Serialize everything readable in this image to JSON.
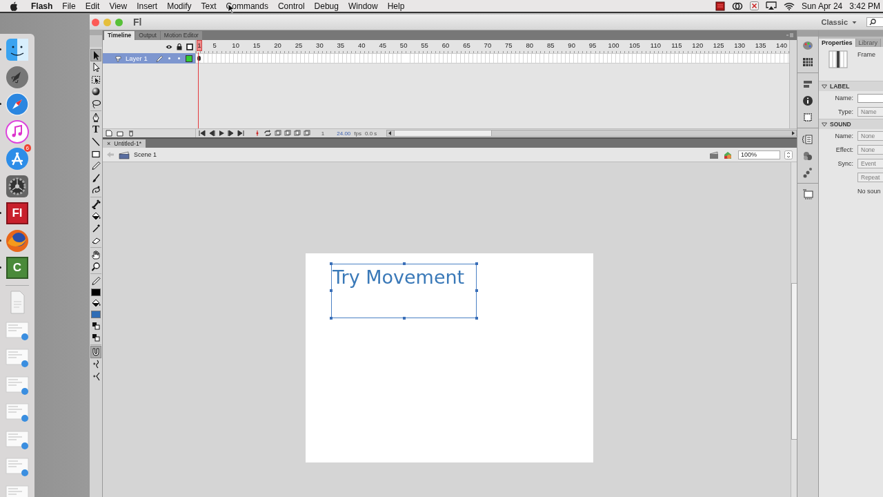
{
  "menubar": {
    "app": "Flash",
    "menus": [
      "File",
      "Edit",
      "View",
      "Insert",
      "Modify",
      "Text",
      "Commands",
      "Control",
      "Debug",
      "Window",
      "Help"
    ],
    "date": "Sun Apr 24",
    "time": "3:42 PM"
  },
  "dock": {
    "items": [
      {
        "kind": "finder",
        "running": true
      },
      {
        "kind": "rocket",
        "running": false
      },
      {
        "kind": "compass",
        "running": true
      },
      {
        "kind": "music",
        "running": false
      },
      {
        "kind": "appstore",
        "running": false,
        "badge": "6"
      },
      {
        "kind": "gear",
        "running": false
      },
      {
        "kind": "tile",
        "label": "Fl",
        "color": "#c8202c",
        "running": true
      },
      {
        "kind": "globe",
        "running": true
      },
      {
        "kind": "tile",
        "label": "C",
        "color": "#4a8a3a",
        "running": true
      },
      {
        "kind": "divider"
      },
      {
        "kind": "document"
      },
      {
        "kind": "thumbnail"
      },
      {
        "kind": "thumbnail"
      },
      {
        "kind": "thumbnail"
      },
      {
        "kind": "thumbnail"
      },
      {
        "kind": "thumbnail"
      },
      {
        "kind": "thumbnail"
      },
      {
        "kind": "thumbnail"
      }
    ]
  },
  "window": {
    "title": "Fl",
    "workspace": "Classic"
  },
  "tools": [
    {
      "kind": "arrow",
      "active": true
    },
    {
      "kind": "subselect",
      "active": false
    },
    {
      "kind": "transform",
      "active": false
    },
    {
      "kind": "sphere",
      "active": false
    },
    {
      "kind": "lasso",
      "active": false
    },
    {
      "kind": "separator"
    },
    {
      "kind": "pen",
      "active": false
    },
    {
      "kind": "text",
      "label": "T",
      "active": false
    },
    {
      "kind": "line",
      "active": false
    },
    {
      "kind": "rect",
      "active": false
    },
    {
      "kind": "pencil",
      "active": false
    },
    {
      "kind": "brush",
      "active": false
    },
    {
      "kind": "deco",
      "active": false
    },
    {
      "kind": "separator"
    },
    {
      "kind": "bone",
      "active": false
    },
    {
      "kind": "bucket",
      "active": false
    },
    {
      "kind": "dropper",
      "active": false
    },
    {
      "kind": "eraser",
      "active": false
    },
    {
      "kind": "separator"
    },
    {
      "kind": "hand",
      "active": false
    },
    {
      "kind": "zoom",
      "active": false
    },
    {
      "kind": "separator"
    },
    {
      "kind": "pencil",
      "active": false
    },
    {
      "kind": "swatch",
      "color": "#000000"
    },
    {
      "kind": "bucket",
      "active": false
    },
    {
      "kind": "swatch",
      "color": "#2f6db5"
    },
    {
      "kind": "swap",
      "active": false
    },
    {
      "kind": "swap",
      "active": false
    },
    {
      "kind": "separator"
    },
    {
      "kind": "magnet",
      "active": true
    },
    {
      "kind": "smooth",
      "active": false
    },
    {
      "kind": "straighten",
      "active": false
    }
  ],
  "timeline": {
    "tabs": [
      {
        "label": "Timeline",
        "selected": true
      },
      {
        "label": "Output",
        "selected": false
      },
      {
        "label": "Motion Editor",
        "selected": false
      }
    ],
    "ruler": [
      "1",
      "5",
      "10",
      "15",
      "20",
      "25",
      "30",
      "35",
      "40",
      "45",
      "50",
      "55",
      "60",
      "65",
      "70",
      "75",
      "80",
      "85",
      "90",
      "95",
      "100",
      "105",
      "110",
      "115",
      "120",
      "125",
      "130",
      "135",
      "140"
    ],
    "layers": [
      {
        "name": "Layer 1",
        "selected": true,
        "color": "#33cc33"
      }
    ],
    "footer": {
      "frame": "1",
      "fps": "24.00",
      "fps_unit": "fps",
      "time": "0.0 s"
    }
  },
  "document": {
    "tab": {
      "close": "×",
      "label": "Untitled-1*"
    },
    "scene": "Scene 1",
    "zoom": "100%",
    "text": "Try Movement"
  },
  "properties": {
    "tabs": [
      {
        "label": "Properties",
        "selected": true
      },
      {
        "label": "Library",
        "selected": false
      }
    ],
    "title": "Frame",
    "sections": [
      {
        "title": "LABEL",
        "expanded": true,
        "rows": [
          {
            "kind": "input",
            "label": "Name:"
          },
          {
            "kind": "select",
            "label": "Type:",
            "value": "Name"
          }
        ]
      },
      {
        "title": "SOUND",
        "expanded": true,
        "rows": [
          {
            "kind": "select",
            "label": "Name:",
            "value": "None"
          },
          {
            "kind": "select",
            "label": "Effect:",
            "value": "None"
          },
          {
            "kind": "select",
            "label": "Sync:",
            "value": "Event"
          },
          {
            "kind": "select",
            "value": "Repeat"
          },
          {
            "kind": "note",
            "value": "No soun"
          }
        ]
      }
    ]
  }
}
